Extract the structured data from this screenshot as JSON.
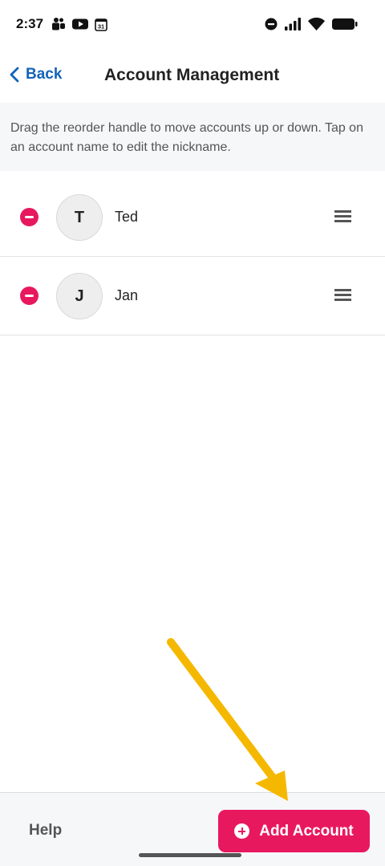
{
  "status_bar": {
    "time": "2:37",
    "left_icons": [
      "teams-icon",
      "youtube-icon",
      "calendar-icon"
    ],
    "calendar_date": "31",
    "right_icons": [
      "do-not-disturb-icon",
      "signal-icon",
      "wifi-icon",
      "battery-icon"
    ]
  },
  "header": {
    "back_label": "Back",
    "title": "Account Management"
  },
  "instructions": "Drag the reorder handle to move accounts up or down. Tap on an account name to edit the nickname.",
  "accounts": [
    {
      "initial": "T",
      "name": "Ted"
    },
    {
      "initial": "J",
      "name": "Jan"
    }
  ],
  "footer": {
    "help_label": "Help",
    "add_label": "Add Account"
  },
  "colors": {
    "accent": "#e8185f",
    "link": "#1463b8",
    "annotation_arrow": "#f5b800"
  }
}
